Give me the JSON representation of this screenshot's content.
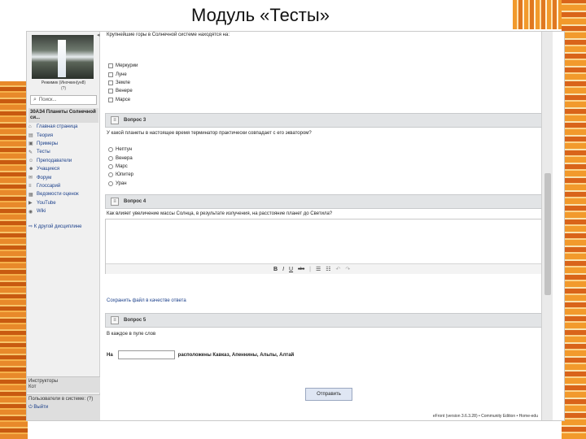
{
  "slide": {
    "title": "Модуль «Тесты»"
  },
  "sidebar": {
    "user_name": "Режимик (Иночкин(ун8)",
    "user_status": "(?)",
    "search_placeholder": "Поиск...",
    "course_title": "30АЗ4 Планеты Солнечной си...",
    "nav_items": [
      {
        "label": "Главная страница",
        "icon": "home-icon"
      },
      {
        "label": "Теория",
        "icon": "book-icon"
      },
      {
        "label": "Примеры",
        "icon": "example-icon"
      },
      {
        "label": "Тесты",
        "icon": "test-icon"
      },
      {
        "label": "Преподаватели",
        "icon": "teacher-icon"
      },
      {
        "label": "Учащиеся",
        "icon": "students-icon"
      },
      {
        "label": "Форум",
        "icon": "forum-icon"
      },
      {
        "label": "Глоссарий",
        "icon": "glossary-icon"
      },
      {
        "label": "Ведомости оценок",
        "icon": "grades-icon"
      },
      {
        "label": "YouTube",
        "icon": "youtube-icon"
      },
      {
        "label": "Wiki",
        "icon": "wiki-icon"
      }
    ],
    "other_courses": "К другой дисциплине",
    "instructors_title": "Инструкторы",
    "instructors_name": "Кот",
    "online_title": "Пользователи в системе:",
    "online_count": "(?)",
    "logout": "Выйти"
  },
  "main": {
    "q1_text": "Крупнейшие горы в Солнечной системе находятся на:",
    "q1_options": [
      "Меркурии",
      "Луне",
      "Земле",
      "Венере",
      "Марсе"
    ],
    "q3_header": "Вопрос 3",
    "q3_text": "У какой планеты в настоящее время терминатор практически совпадает с его экватором?",
    "q3_options": [
      "Нептун",
      "Венера",
      "Марс",
      "Юпитер",
      "Уран"
    ],
    "q4_header": "Вопрос 4",
    "q4_text": "Как влияет увеличение массы Солнца, в результате излучения, на расстояние планет до Светила?",
    "editor_tools": {
      "bold": "B",
      "italic": "I",
      "underline": "U",
      "strike": "abc",
      "list_bullet": "☰",
      "list_number": "☷",
      "undo": "↶",
      "redo": "↷"
    },
    "attach_link": "Сохранить файл в качестве ответа",
    "q5_header": "Вопрос 5",
    "q5_text": "В каждое в пуле слов",
    "q5_prefix": "На",
    "q5_suffix": "расположены Кавказ, Апеннины, Альпы, Алтай",
    "submit_label": "Отправить",
    "footer": "eFront (version 3.6.3.28) • Community Edition • Home-edu"
  }
}
